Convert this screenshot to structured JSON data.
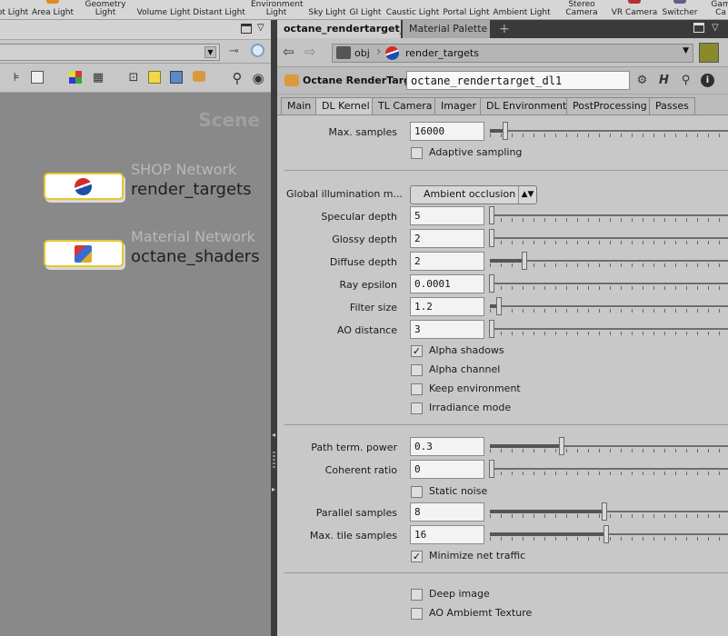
{
  "shelf": {
    "tools": [
      "ot Light",
      "Area Light",
      "Geometry Light",
      "Volume Light",
      "Distant Light",
      "Environment Light",
      "Sky Light",
      "GI Light",
      "Caustic Light",
      "Portal Light",
      "Ambient Light",
      "Stereo Camera",
      "VR Camera",
      "Switcher",
      "Gam Ca"
    ]
  },
  "network": {
    "context_label": "Scene",
    "nodes": [
      {
        "type": "SHOP Network",
        "name": "render_targets",
        "icon": "render-target-icon"
      },
      {
        "type": "Material Network",
        "name": "octane_shaders",
        "icon": "shader-icon"
      }
    ]
  },
  "right_pane": {
    "tabs": [
      "octane_rendertarget_...",
      "Material Palette"
    ],
    "path": {
      "obj": "obj",
      "node": "render_targets"
    },
    "node_type": "Octane RenderTarget",
    "node_name": "octane_rendertarget_dl1",
    "help_glyph": "H"
  },
  "parm_tabs": [
    "Main",
    "DL Kernel",
    "TL Camera",
    "Imager",
    "DL Environment",
    "PostProcessing",
    "Passes"
  ],
  "parms": {
    "max_samples": {
      "label": "Max. samples",
      "value": "16000",
      "slider": 0.06
    },
    "adaptive_sampling": {
      "label": "Adaptive sampling",
      "checked": false
    },
    "gi_mode": {
      "label": "Global illumination m...",
      "value": "Ambient occlusion"
    },
    "specular_depth": {
      "label": "Specular depth",
      "value": "5",
      "slider": 0.0
    },
    "glossy_depth": {
      "label": "Glossy depth",
      "value": "2",
      "slider": 0.0
    },
    "diffuse_depth": {
      "label": "Diffuse depth",
      "value": "2",
      "slider": 0.14
    },
    "ray_epsilon": {
      "label": "Ray epsilon",
      "value": "0.0001",
      "slider": 0.0
    },
    "filter_size": {
      "label": "Filter size",
      "value": "1.2",
      "slider": 0.03
    },
    "ao_distance": {
      "label": "AO distance",
      "value": "3",
      "slider": 0.0
    },
    "alpha_shadows": {
      "label": "Alpha shadows",
      "checked": true
    },
    "alpha_channel": {
      "label": "Alpha channel",
      "checked": false
    },
    "keep_environment": {
      "label": "Keep environment",
      "checked": false
    },
    "irradiance_mode": {
      "label": "Irradiance mode",
      "checked": false
    },
    "path_term_power": {
      "label": "Path term. power",
      "value": "0.3",
      "slider": 0.3
    },
    "coherent_ratio": {
      "label": "Coherent ratio",
      "value": "0",
      "slider": 0.0
    },
    "static_noise": {
      "label": "Static noise",
      "checked": false
    },
    "parallel_samples": {
      "label": "Parallel samples",
      "value": "8",
      "slider": 0.48
    },
    "max_tile_samples": {
      "label": "Max. tile samples",
      "value": "16",
      "slider": 0.49
    },
    "minimize_net_traffic": {
      "label": "Minimize net traffic",
      "checked": true
    },
    "deep_image": {
      "label": "Deep image",
      "checked": false
    },
    "ao_ambient_texture": {
      "label": "AO Ambiemt Texture",
      "checked": false
    }
  }
}
